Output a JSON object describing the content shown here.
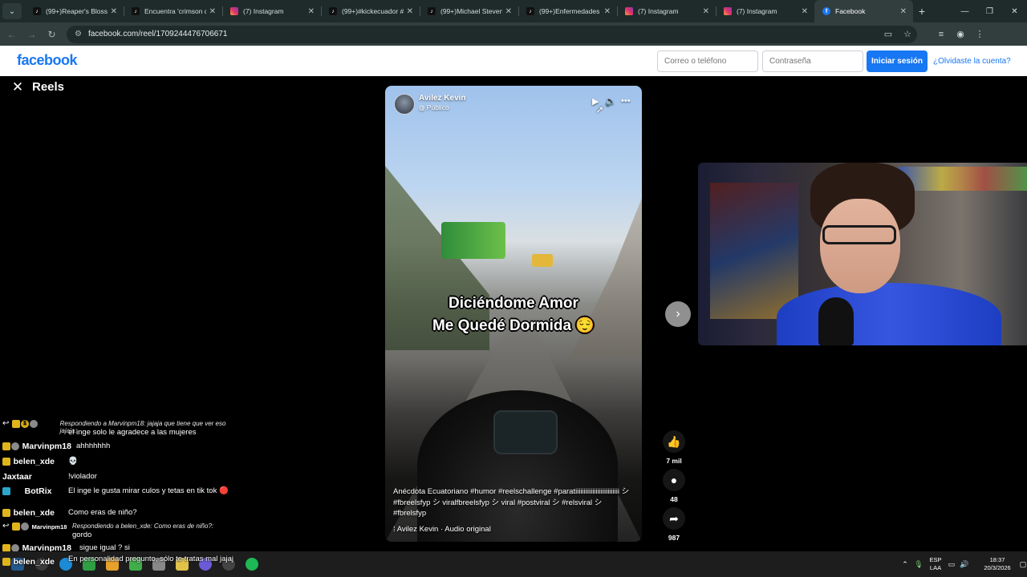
{
  "browser": {
    "tabs": [
      {
        "title": "(99+)Reaper's Blosso",
        "favicon": "tiktok-icon",
        "active": false
      },
      {
        "title": "Encuentra 'crimson d",
        "favicon": "tiktok-icon",
        "active": false
      },
      {
        "title": "(7) Instagram",
        "favicon": "instagram-icon",
        "active": false
      },
      {
        "title": "(99+)#kickecuador #",
        "favicon": "tiktok-icon",
        "active": false
      },
      {
        "title": "(99+)Michael Steven",
        "favicon": "tiktok-icon",
        "active": false
      },
      {
        "title": "(99+)Enfermedades",
        "favicon": "tiktok-icon",
        "active": false
      },
      {
        "title": "(7) Instagram",
        "favicon": "instagram-icon",
        "active": false
      },
      {
        "title": "(7) Instagram",
        "favicon": "instagram-icon",
        "active": false
      },
      {
        "title": "Facebook",
        "favicon": "facebook-icon",
        "active": true
      }
    ],
    "url": "facebook.com/reel/1709244476706671"
  },
  "header": {
    "logo": "facebook",
    "email_placeholder": "Correo o teléfono",
    "password_placeholder": "Contraseña",
    "login_label": "Iniciar sesión",
    "forgot_label": "¿Olvidaste la cuenta?"
  },
  "reels": {
    "title": "Reels"
  },
  "video": {
    "author": "Avilez Kevin",
    "privacy": "Público",
    "caption_line1": "Diciéndome Amor",
    "caption_line2": "Me Quedé Dormida 😌",
    "description": "Anécdota Ecuatoriano #humor #reelschallenge #paratiiiiiiiiiiiiiiiiiiiiiiiiii シ #fbreelsfyp シ viralfbreelsfyp シ viral #postviral シ #relsviral シ #fbrelsfyp",
    "audio": "Avilez Kevin · Audio original"
  },
  "actions": {
    "likes": "7 mil",
    "comments": "48",
    "shares": "987"
  },
  "chat": [
    {
      "reply_context": "Respondiendo a Marvinpm18: jajaja que tiene que ver eso jajaja:",
      "message": "el inge solo le agradece a las mujeres",
      "user": ""
    },
    {
      "user": "Marvinpm18",
      "message": "ahhhhhhh"
    },
    {
      "user": "belen_xde",
      "message": "💀"
    },
    {
      "user": "Jaxtaar",
      "message": "!violador"
    },
    {
      "user": "BotRix",
      "message": "El inge le gusta mirar culos y tetas en tik tok 🔴"
    },
    {
      "user": "belen_xde",
      "message": "Como eras de niño?"
    },
    {
      "user": "Marvinpm18",
      "reply_context": "Respondiendo a belen_xde: Como eras de niño?:",
      "message": "gordo"
    },
    {
      "user": "Marvinpm18",
      "message": "sigue igual ? si"
    },
    {
      "user": "belen_xde",
      "message": "En personalidad pregunto, sólo te tratas mal jajaj"
    }
  ],
  "taskbar": {
    "language": "ESP",
    "language_sub": "LAA",
    "time": "18:37",
    "date": "20/3/2026"
  },
  "colors": {
    "facebook_blue": "#1877f2",
    "crown_badge": "#e0b51b"
  }
}
